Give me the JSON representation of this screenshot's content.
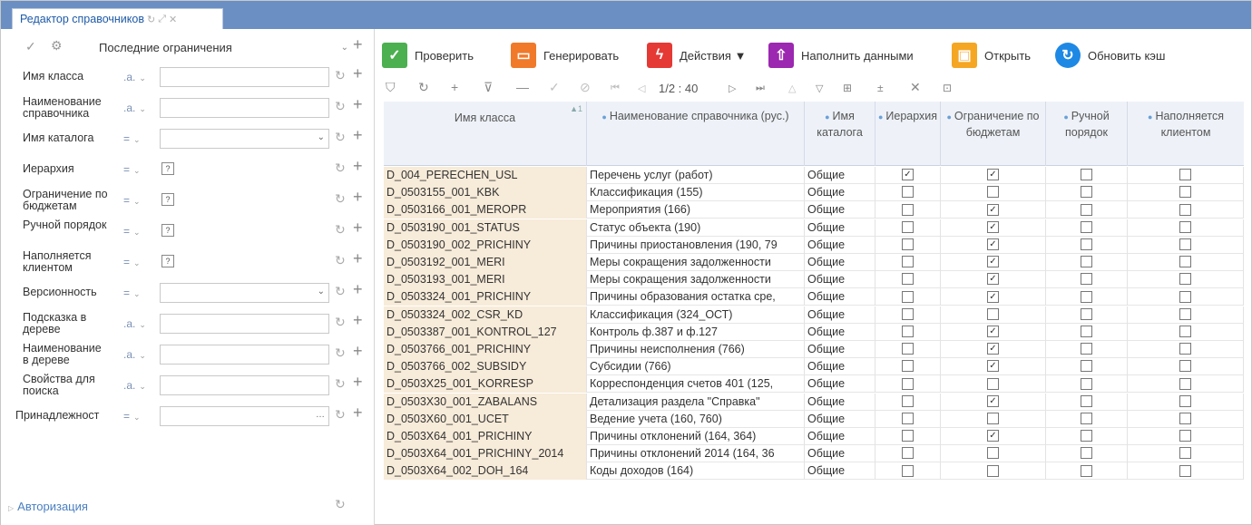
{
  "tab": {
    "title": "Редактор справочников",
    "icons": [
      "refresh-icon",
      "expand-icon",
      "close-icon"
    ]
  },
  "filter_panel": {
    "preset": "Последние ограничения",
    "rows": [
      {
        "label": "Имя класса",
        "op": ".a.",
        "type": "text"
      },
      {
        "label": "Наименование справочника",
        "op": ".a.",
        "type": "text"
      },
      {
        "label": "Имя каталога",
        "op": "=",
        "type": "select"
      },
      {
        "label": "Иерархия",
        "op": "=",
        "type": "check",
        "check_value": "?"
      },
      {
        "label": "Ограничение по бюджетам",
        "op": "=",
        "type": "check",
        "check_value": "?"
      },
      {
        "label": "Ручной порядок",
        "op": "=",
        "type": "check",
        "check_value": "?"
      },
      {
        "label": "Наполняется клиентом",
        "op": "=",
        "type": "check",
        "check_value": "?"
      },
      {
        "label": "Версионность",
        "op": "=",
        "type": "select"
      },
      {
        "label": "Подсказка в дереве",
        "op": ".a.",
        "type": "text"
      },
      {
        "label": "Наименование в дереве",
        "op": ".a.",
        "type": "text"
      },
      {
        "label": "Свойства для поиска",
        "op": ".a.",
        "type": "text"
      },
      {
        "label": "Принадлежност",
        "op": "=",
        "type": "lookup"
      }
    ],
    "authorization": "Авторизация"
  },
  "toolbar": {
    "check": "Проверить",
    "generate": "Генерировать",
    "actions": "Действия ▼",
    "fill": "Наполнить данными",
    "open": "Открыть",
    "refresh_cache": "Обновить кэш"
  },
  "pager": {
    "text": "1/2 : 40"
  },
  "grid": {
    "columns": [
      "Имя класса",
      "Наименование справочника (рус.)",
      "Имя каталога",
      "Иерархия",
      "Ограничение по бюджетам",
      "Ручной порядок",
      "Наполняется клиентом"
    ],
    "rows": [
      [
        "D_004_PERECHEN_USL",
        "Перечень услуг (работ)",
        "Общие",
        true,
        true,
        false,
        false
      ],
      [
        "D_0503155_001_KBK",
        "Классификация (155)",
        "Общие",
        false,
        false,
        false,
        false
      ],
      [
        "D_0503166_001_MEROPR",
        "Мероприятия (166)",
        "Общие",
        false,
        true,
        false,
        false
      ],
      [
        "D_0503190_001_STATUS",
        "Статус объекта (190)",
        "Общие",
        false,
        true,
        false,
        false
      ],
      [
        "D_0503190_002_PRICHINY",
        "Причины приостановления (190, 79",
        "Общие",
        false,
        true,
        false,
        false
      ],
      [
        "D_0503192_001_MERI",
        "Меры сокращения задолженности",
        "Общие",
        false,
        true,
        false,
        false
      ],
      [
        "D_0503193_001_MERI",
        "Меры сокращения задолженности",
        "Общие",
        false,
        true,
        false,
        false
      ],
      [
        "D_0503324_001_PRICHINY",
        "Причины образования остатка сре,",
        "Общие",
        false,
        true,
        false,
        false
      ],
      [
        "D_0503324_002_CSR_KD",
        "Классификация (324_ОСТ)",
        "Общие",
        false,
        false,
        false,
        false
      ],
      [
        "D_0503387_001_KONTROL_127",
        "Контроль ф.387 и ф.127",
        "Общие",
        false,
        true,
        false,
        false
      ],
      [
        "D_0503766_001_PRICHINY",
        "Причины неисполнения (766)",
        "Общие",
        false,
        true,
        false,
        false
      ],
      [
        "D_0503766_002_SUBSIDY",
        "Субсидии (766)",
        "Общие",
        false,
        true,
        false,
        false
      ],
      [
        "D_0503X25_001_KORRESP",
        "Корреспонденция счетов 401 (125,",
        "Общие",
        false,
        false,
        false,
        false
      ],
      [
        "D_0503X30_001_ZABALANS",
        "Детализация раздела \"Справка\"",
        "Общие",
        false,
        true,
        false,
        false
      ],
      [
        "D_0503X60_001_UCET",
        "Ведение учета (160, 760)",
        "Общие",
        false,
        false,
        false,
        false
      ],
      [
        "D_0503X64_001_PRICHINY",
        "Причины отклонений (164, 364)",
        "Общие",
        false,
        true,
        false,
        false
      ],
      [
        "D_0503X64_001_PRICHINY_2014",
        "Причины отклонений 2014 (164, 36",
        "Общие",
        false,
        false,
        false,
        false
      ],
      [
        "D_0503X64_002_DOH_164",
        "Коды доходов (164)",
        "Общие",
        false,
        false,
        false,
        false
      ]
    ]
  },
  "colors": {
    "titlebar": "#6b8fc2",
    "check": "#4caf50",
    "generate": "#f07a2a",
    "actions": "#e53935",
    "fill": "#9c27b0",
    "open": "#f5a623",
    "refresh": "#1e88e5"
  }
}
